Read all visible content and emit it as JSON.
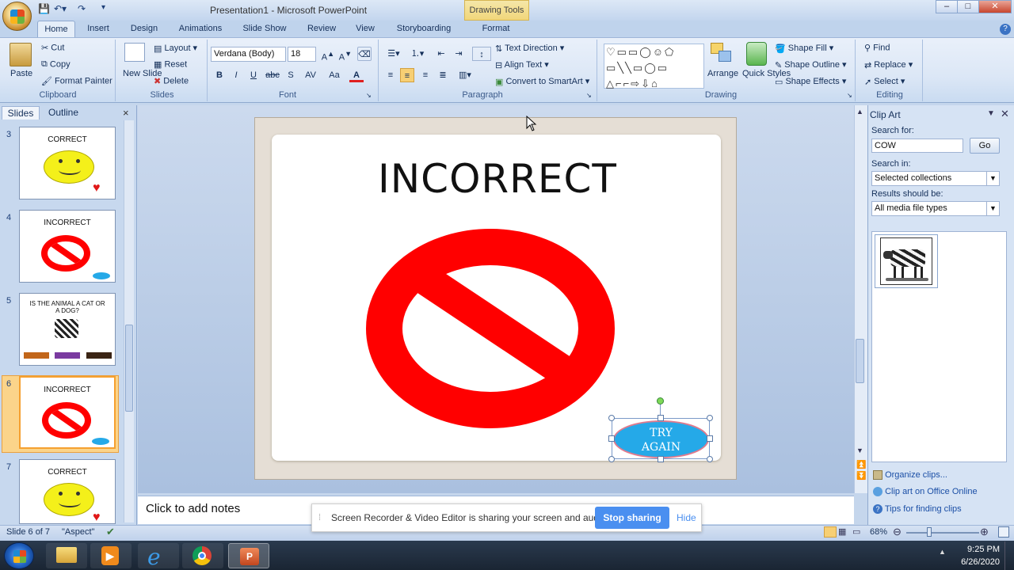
{
  "window": {
    "title": "Presentation1 - Microsoft PowerPoint",
    "contextual_tab_group": "Drawing Tools",
    "controls": [
      "–",
      "□",
      "✕"
    ]
  },
  "tabs": [
    "Home",
    "Insert",
    "Design",
    "Animations",
    "Slide Show",
    "Review",
    "View",
    "Storyboarding",
    "Format"
  ],
  "ribbon": {
    "clipboard": {
      "paste": "Paste",
      "cut": "Cut",
      "copy": "Copy",
      "format_painter": "Format Painter",
      "label": "Clipboard"
    },
    "slides": {
      "new_slide": "New Slide",
      "layout": "Layout",
      "reset": "Reset",
      "delete": "Delete",
      "label": "Slides"
    },
    "font": {
      "font_name": "Verdana (Body)",
      "font_size": "18",
      "label": "Font",
      "bold": "B",
      "italic": "I",
      "underline": "U",
      "strike": "abc",
      "shadow": "S",
      "spacing": "AV",
      "case": "Aa",
      "color": "A"
    },
    "paragraph": {
      "text_direction": "Text Direction",
      "align_text": "Align Text",
      "convert_smartart": "Convert to SmartArt",
      "label": "Paragraph"
    },
    "drawing": {
      "arrange": "Arrange",
      "quick_styles": "Quick Styles",
      "shape_fill": "Shape Fill",
      "shape_outline": "Shape Outline",
      "shape_effects": "Shape Effects",
      "label": "Drawing"
    },
    "editing": {
      "find": "Find",
      "replace": "Replace",
      "select": "Select",
      "label": "Editing"
    }
  },
  "left_pane": {
    "tabs": [
      "Slides",
      "Outline"
    ],
    "close": "×",
    "slides": [
      {
        "num": "3",
        "title": "CORRECT"
      },
      {
        "num": "4",
        "title": "INCORRECT"
      },
      {
        "num": "5",
        "title": "IS THE ANIMAL A CAT OR A DOG?"
      },
      {
        "num": "6",
        "title": "INCORRECT"
      },
      {
        "num": "7",
        "title": "CORRECT"
      }
    ]
  },
  "slide": {
    "heading": "INCORRECT",
    "button_line1": "TRY",
    "button_line2": "AGAIN"
  },
  "notes_placeholder": "Click to add notes",
  "clip_art": {
    "title": "Clip Art",
    "search_for_label": "Search for:",
    "search_value": "COW",
    "go": "Go",
    "search_in_label": "Search in:",
    "search_in_value": "Selected collections",
    "results_label": "Results should be:",
    "results_value": "All media file types",
    "links": [
      "Organize clips...",
      "Clip art on Office Online",
      "Tips for finding clips"
    ]
  },
  "share_bar": {
    "message": "Screen Recorder & Video Editor is sharing your screen and audio.",
    "stop": "Stop sharing",
    "hide": "Hide"
  },
  "status_bar": {
    "slide_info": "Slide 6 of 7",
    "theme": "\"Aspect\"",
    "zoom": "68%"
  },
  "taskbar": {
    "time": "9:25 PM",
    "date": "6/26/2020"
  },
  "colors": {
    "accent": "#2e5fa8",
    "prohibit_red": "#ff0000",
    "try_again_blue": "#25a9e8",
    "stop_sharing_blue": "#4a8ff0"
  }
}
